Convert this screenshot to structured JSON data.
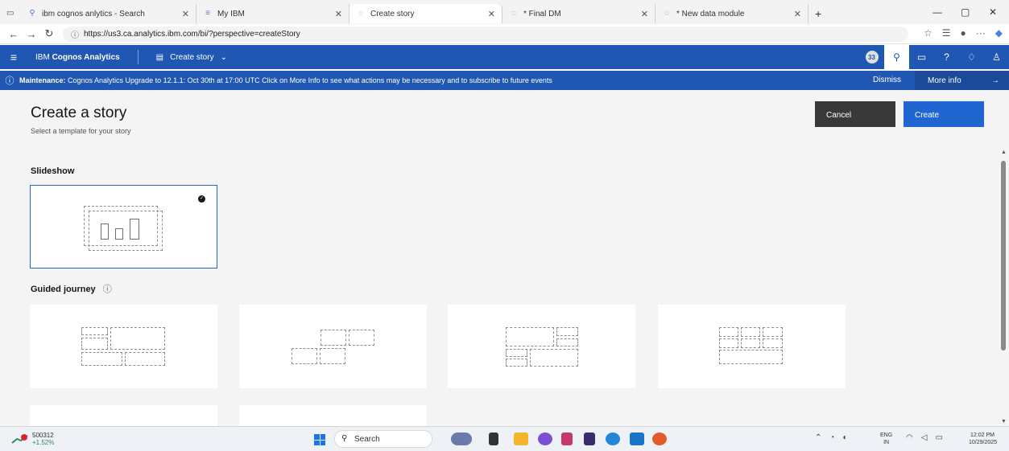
{
  "browser": {
    "tabs": [
      {
        "label": "ibm cognos anlytics - Search",
        "icon": "search-icon",
        "active": false
      },
      {
        "label": "My IBM",
        "icon": "ibm-icon",
        "active": false
      },
      {
        "label": "Create story",
        "icon": "loading-icon",
        "active": true
      },
      {
        "label": "* Final DM",
        "icon": "loading-icon",
        "active": false
      },
      {
        "label": "* New data module",
        "icon": "loading-icon",
        "active": false
      }
    ],
    "url": "https://us3.ca.analytics.ibm.com/bi/?perspective=createStory"
  },
  "appbar": {
    "brand_prefix": "IBM ",
    "brand_name": "Cognos Analytics",
    "story_menu_label": "Create story",
    "badge": "33"
  },
  "banner": {
    "label": "Maintenance:",
    "message": " Cognos Analytics Upgrade to 12.1.1: Oct 30th at 17:00 UTC Click on More Info to see what actions may be necessary and to subscribe to future events",
    "dismiss": "Dismiss",
    "more_info": "More info"
  },
  "page": {
    "title": "Create a story",
    "subtitle": "Select a template for your story",
    "cancel": "Cancel",
    "create": "Create"
  },
  "sections": {
    "slideshow": "Slideshow",
    "guided": "Guided journey"
  },
  "taskbar": {
    "stock_value": "500312",
    "stock_change": "+1.52%",
    "search_placeholder": "Search",
    "lang_top": "ENG",
    "lang_bottom": "IN",
    "time": "12:02 PM",
    "date": "10/29/2025"
  },
  "colors": {
    "ibm_blue": "#1f57b3",
    "primary": "#1f66d1",
    "secondary": "#393939"
  }
}
